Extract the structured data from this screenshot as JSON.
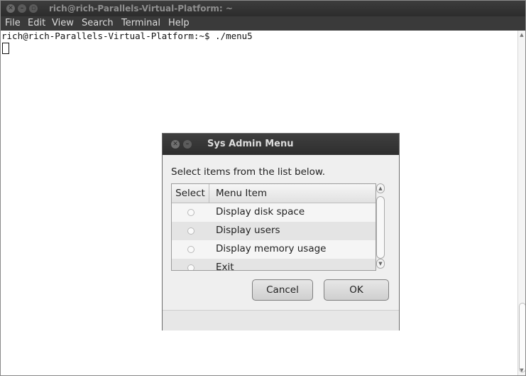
{
  "terminal_window": {
    "title": "rich@rich-Parallels-Virtual-Platform: ~",
    "menu": [
      "File",
      "Edit",
      "View",
      "Search",
      "Terminal",
      "Help"
    ],
    "prompt_line": "rich@rich-Parallels-Virtual-Platform:~$ ./menu5"
  },
  "dialog": {
    "title": "Sys Admin Menu",
    "message": "Select items from the list below.",
    "columns": [
      "Select",
      "Menu Item"
    ],
    "items": [
      "Display disk space",
      "Display users",
      "Display memory usage",
      "Exit"
    ],
    "buttons": {
      "cancel": "Cancel",
      "ok": "OK"
    }
  },
  "icons": {
    "close": "close-icon",
    "minimize": "minimize-icon",
    "maximize": "maximize-icon",
    "scroll_up": "chevron-up-icon",
    "scroll_down": "chevron-down-icon"
  }
}
